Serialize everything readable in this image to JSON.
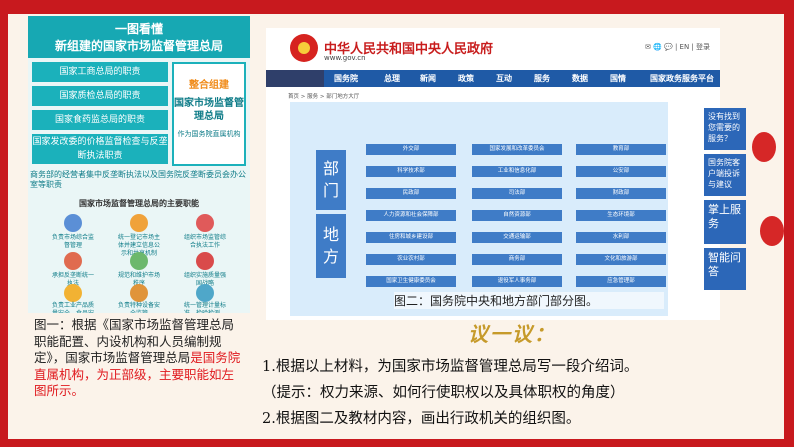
{
  "infographic": {
    "title_line1": "一图看懂",
    "title_line2": "新组建的国家市场监督管理总局",
    "bars": [
      "国家工商总局的职责",
      "国家质检总局的职责",
      "国家食药监总局的职责",
      "国家发改委的价格监督检查与反垄断执法职责"
    ],
    "merge_head": "整合组建",
    "merge_body": "国家市场监督管理总局",
    "merge_sub": "作为国务院直属机构",
    "merge_note": "商务部的经营者集中反垄断执法以及国务院反垄断委员会办公室等职责",
    "func_title": "国家市场监督管理总局的主要职能",
    "func_items": [
      "负责市场综合监督管理",
      "统一登记市场主体并建立信息公示和共享机制",
      "组织市场监管综合执法工作",
      "承担反垄断统一执法",
      "规范和维护市场秩序",
      "组织实施质量强国战略",
      "负责工业产品质量安全、食品安全",
      "负责特种设备安全监管",
      "统一管理计量标准、检验检测、认证认可工作"
    ]
  },
  "caption1": {
    "part1": "图一：根据《国家市场监督管理总局职能配置、内设机构和人员编制规定》，国家市场监督管理总局",
    "part2": "是国务院直属机构，为正部级，主要职能如左图所示。"
  },
  "gov_site": {
    "title": "中华人民共和国中央人民政府",
    "url": "www.gov.cn",
    "tools": "✉ 🌐 💬 | EN | 登录",
    "nav": [
      "国务院",
      "总理",
      "新闻",
      "政策",
      "互动",
      "服务",
      "数据",
      "国情",
      "国家政务服务平台"
    ],
    "breadcrumb": "首页  >  服务  >  部门地方大厅",
    "side_labels": [
      "部门",
      "地方"
    ],
    "depts": [
      [
        "外交部",
        "国家发展和改革委员会",
        "教育部"
      ],
      [
        "科学技术部",
        "工业和信息化部",
        "公安部"
      ],
      [
        "民政部",
        "司法部",
        "财政部"
      ],
      [
        "人力资源和社会保障部",
        "自然资源部",
        "生态环境部"
      ],
      [
        "住房和城乡建设部",
        "交通运输部",
        "水利部"
      ],
      [
        "农业农村部",
        "商务部",
        "文化和旅游部"
      ],
      [
        "国家卫生健康委员会",
        "退役军人事务部",
        "应急管理部"
      ]
    ],
    "right_buttons": [
      "没有找到您需要的服务？",
      "国务院客户端投诉与建议",
      "掌上服务",
      "智能问答"
    ],
    "caption": "图二：国务院中央和地方部门部分图。"
  },
  "discuss": {
    "title": "议一议：",
    "q1": "1.根据以上材料，为国家市场监督管理总局写一段介绍词。",
    "q1_hint": "（提示：权力来源、如何行使职权以及具体职权的角度）",
    "q2": "2.根据图二及教材内容，画出行政机关的组织图。"
  },
  "colors": {
    "frame": "#c8191e",
    "teal": "#17a8b3",
    "gov_blue": "#1f5aa6",
    "discuss_gold": "#c69a2a"
  }
}
